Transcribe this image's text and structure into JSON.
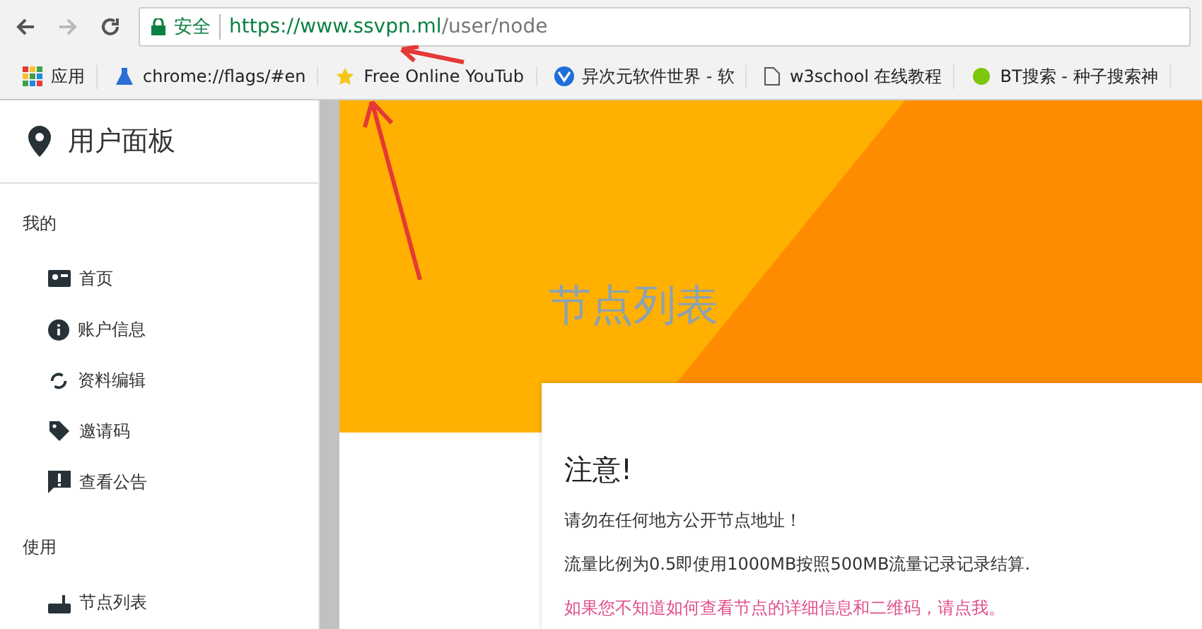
{
  "address_bar": {
    "secure_label": "安全",
    "url_host": "https://www.ssvpn.ml",
    "url_path": "/user/node"
  },
  "bookmarks": [
    {
      "kind": "apps",
      "label": "应用"
    },
    {
      "kind": "flask",
      "label": "chrome://flags/#en"
    },
    {
      "kind": "star",
      "label": "Free Online YouTub"
    },
    {
      "kind": "logo",
      "label": "异次元软件世界 - 软"
    },
    {
      "kind": "page",
      "label": "w3school 在线教程"
    },
    {
      "kind": "ball",
      "label": "BT搜索 - 种子搜索神"
    }
  ],
  "sidebar": {
    "title": "用户面板",
    "sections": [
      {
        "label": "我的",
        "items": [
          {
            "kind": "card",
            "label": "首页"
          },
          {
            "kind": "info",
            "label": "账户信息"
          },
          {
            "kind": "sync",
            "label": "资料编辑"
          },
          {
            "kind": "tag",
            "label": "邀请码"
          },
          {
            "kind": "alert",
            "label": "查看公告"
          }
        ]
      },
      {
        "label": "使用",
        "items": [
          {
            "kind": "router",
            "label": "节点列表"
          }
        ]
      }
    ]
  },
  "page_heading": "节点列表",
  "notice": {
    "title": "注意!",
    "lines": [
      {
        "kind": "plain",
        "text": "请勿在任何地方公开节点地址！"
      },
      {
        "kind": "plain",
        "text": "流量比例为0.5即使用1000MB按照500MB流量记录记录结算."
      },
      {
        "kind": "link",
        "text": "如果您不知道如何查看节点的详细信息和二维码，请点我。"
      }
    ]
  }
}
